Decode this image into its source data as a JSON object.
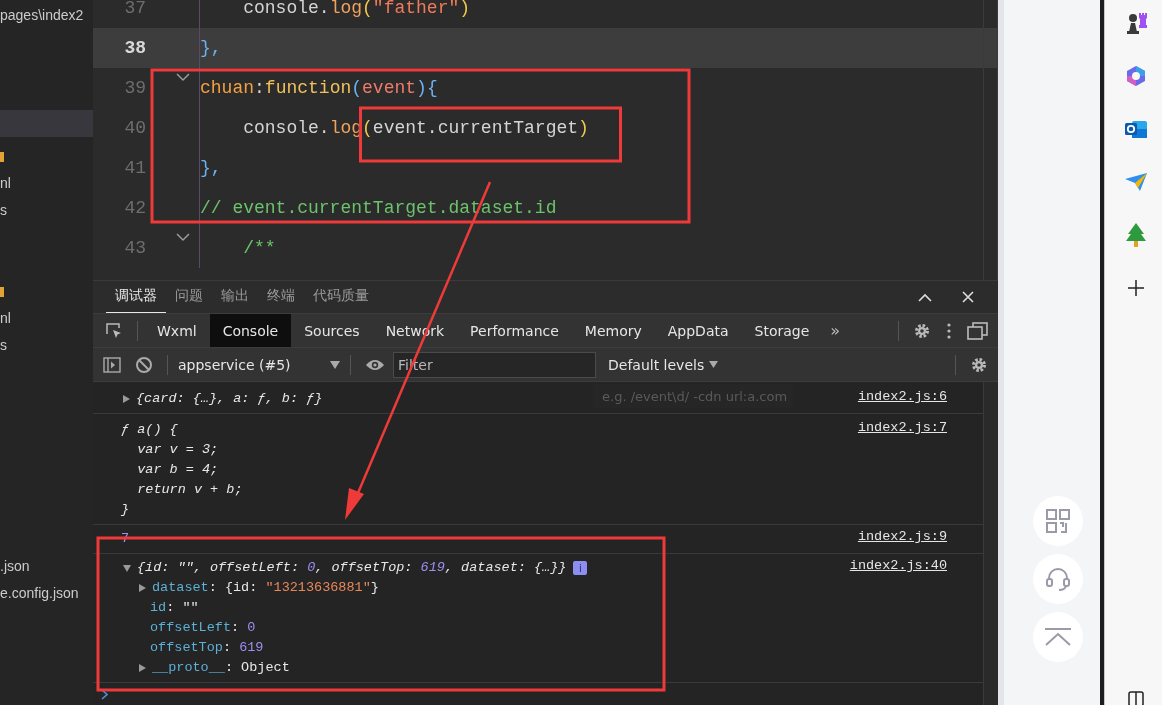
{
  "sidebar": {
    "items": [
      {
        "kind": "path",
        "label": "pages\\index2",
        "selected": false
      },
      {
        "kind": "row",
        "selected": true
      },
      {
        "kind": "folder",
        "selected": false
      },
      {
        "kind": "file",
        "label": "nl",
        "selected": false
      },
      {
        "kind": "file",
        "label": "s",
        "selected": false
      },
      {
        "kind": "folder",
        "selected": false
      },
      {
        "kind": "file",
        "label": "nl",
        "selected": false
      },
      {
        "kind": "file",
        "label": "s",
        "selected": false
      },
      {
        "kind": "file",
        "label": ".json",
        "selected": false
      },
      {
        "kind": "file",
        "label": "e.config.json",
        "selected": false
      }
    ]
  },
  "editor": {
    "lines": [
      {
        "number": "37",
        "current": false,
        "foldable": false,
        "tokens": [
          {
            "text": "    console.",
            "kind": "plain"
          },
          {
            "text": "log",
            "kind": "method"
          },
          {
            "text": "(",
            "kind": "paren"
          },
          {
            "text": "\"father\"",
            "kind": "string"
          },
          {
            "text": ")",
            "kind": "paren"
          }
        ]
      },
      {
        "number": "38",
        "current": true,
        "foldable": false,
        "tokens": [
          {
            "text": "},",
            "kind": "brace"
          }
        ]
      },
      {
        "number": "39",
        "current": false,
        "foldable": true,
        "tokens": [
          {
            "text": "chuan",
            "kind": "key"
          },
          {
            "text": ":",
            "kind": "plain"
          },
          {
            "text": "function",
            "kind": "keyword"
          },
          {
            "text": "(",
            "kind": "brace"
          },
          {
            "text": "event",
            "kind": "param"
          },
          {
            "text": "){",
            "kind": "brace"
          }
        ]
      },
      {
        "number": "40",
        "current": false,
        "foldable": false,
        "tokens": [
          {
            "text": "    console.",
            "kind": "plain"
          },
          {
            "text": "log",
            "kind": "method"
          },
          {
            "text": "(",
            "kind": "paren"
          },
          {
            "text": "event.currentTarget",
            "kind": "plain"
          },
          {
            "text": ")",
            "kind": "paren"
          }
        ]
      },
      {
        "number": "41",
        "current": false,
        "foldable": false,
        "tokens": [
          {
            "text": "},",
            "kind": "brace"
          }
        ]
      },
      {
        "number": "42",
        "current": false,
        "foldable": false,
        "tokens": [
          {
            "text": "// event.currentTarget.dataset.id",
            "kind": "comment"
          }
        ]
      },
      {
        "number": "43",
        "current": false,
        "foldable": true,
        "tokens": [
          {
            "text": "    /**",
            "kind": "comment"
          }
        ]
      }
    ]
  },
  "devtools": {
    "panel_tabs": [
      {
        "label": "调试器",
        "selected": true
      },
      {
        "label": "问题",
        "selected": false
      },
      {
        "label": "输出",
        "selected": false
      },
      {
        "label": "终端",
        "selected": false
      },
      {
        "label": "代码质量",
        "selected": false
      }
    ],
    "tool_tabs": [
      {
        "label": "Wxml",
        "selected": false
      },
      {
        "label": "Console",
        "selected": true
      },
      {
        "label": "Sources",
        "selected": false
      },
      {
        "label": "Network",
        "selected": false
      },
      {
        "label": "Performance",
        "selected": false
      },
      {
        "label": "Memory",
        "selected": false
      },
      {
        "label": "AppData",
        "selected": false
      },
      {
        "label": "Storage",
        "selected": false
      }
    ],
    "more": "»",
    "context": "appservice (#5)",
    "filter": {
      "placeholder": "Filter",
      "hint": "e.g. /event\\d/ -cdn url:a.com"
    },
    "levels": "Default levels",
    "console": [
      {
        "kind": "object",
        "expanded": false,
        "source": "index2.js:6",
        "tokens": [
          {
            "text": "{card: {…}, a: ƒ, b: ƒ}",
            "kind": "plain"
          }
        ]
      },
      {
        "kind": "function",
        "source": "index2.js:7",
        "lines": [
          "ƒ a() {",
          "  var v = 3;",
          "  var b = 4;",
          "  return v + b;",
          "}"
        ]
      },
      {
        "kind": "value",
        "source": "index2.js:9",
        "tokens": [
          {
            "text": "7",
            "kind": "number"
          }
        ]
      },
      {
        "kind": "object",
        "expanded": true,
        "source": "index2.js:40",
        "info": "i",
        "tokens": [
          {
            "text": "{id: \"\", offsetLeft: ",
            "kind": "plain"
          },
          {
            "text": "0",
            "kind": "number"
          },
          {
            "text": ", offsetTop: ",
            "kind": "plain"
          },
          {
            "text": "619",
            "kind": "number"
          },
          {
            "text": ", dataset: {…}}",
            "kind": "plain"
          }
        ],
        "children": [
          {
            "expandable": true,
            "expanded": false,
            "tokens": [
              {
                "text": "dataset",
                "kind": "key"
              },
              {
                "text": ": {id: ",
                "kind": "plain"
              },
              {
                "text": "\"13213636881\"",
                "kind": "string"
              },
              {
                "text": "}",
                "kind": "plain"
              }
            ]
          },
          {
            "expandable": false,
            "tokens": [
              {
                "text": "id",
                "kind": "key"
              },
              {
                "text": ": \"\"",
                "kind": "plain"
              }
            ]
          },
          {
            "expandable": false,
            "tokens": [
              {
                "text": "offsetLeft",
                "kind": "key"
              },
              {
                "text": ": ",
                "kind": "plain"
              },
              {
                "text": "0",
                "kind": "number"
              }
            ]
          },
          {
            "expandable": false,
            "tokens": [
              {
                "text": "offsetTop",
                "kind": "key"
              },
              {
                "text": ": ",
                "kind": "plain"
              },
              {
                "text": "619",
                "kind": "number"
              }
            ]
          },
          {
            "expandable": true,
            "expanded": false,
            "tokens": [
              {
                "text": "__proto__",
                "kind": "key"
              },
              {
                "text": ": Object",
                "kind": "plain"
              }
            ]
          }
        ]
      }
    ]
  },
  "annotations": [
    {
      "kind": "box"
    },
    {
      "kind": "box"
    },
    {
      "kind": "box"
    },
    {
      "kind": "arrow"
    }
  ]
}
